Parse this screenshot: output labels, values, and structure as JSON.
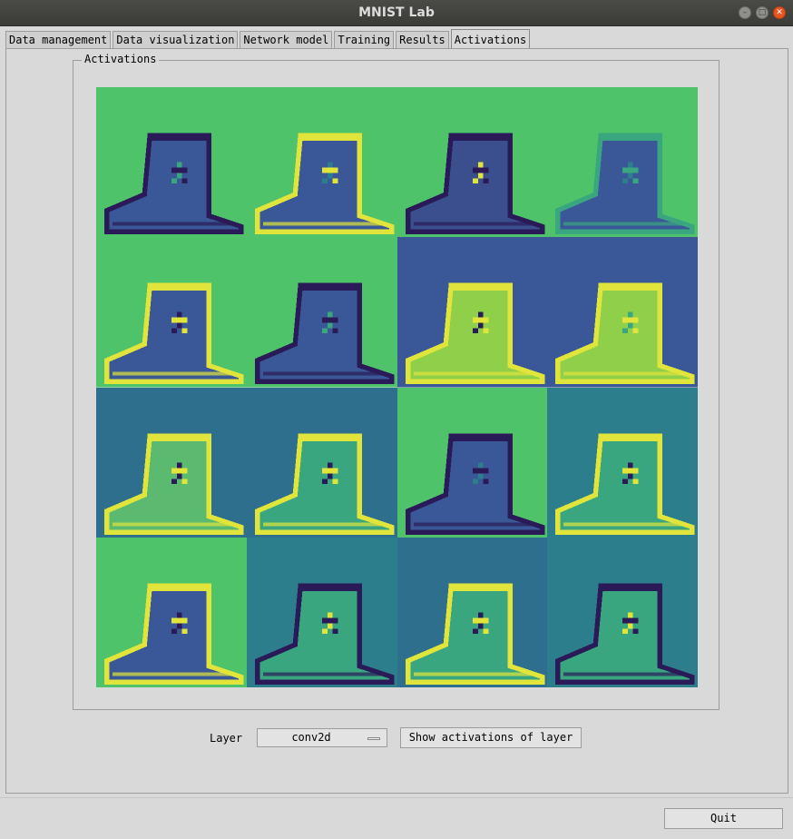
{
  "window": {
    "title": "MNIST Lab"
  },
  "tabs": [
    {
      "label": "Data management",
      "active": false
    },
    {
      "label": "Data visualization",
      "active": false
    },
    {
      "label": "Network model",
      "active": false
    },
    {
      "label": "Training",
      "active": false
    },
    {
      "label": "Results",
      "active": false
    },
    {
      "label": "Activations",
      "active": true
    }
  ],
  "activations": {
    "group_label": "Activations",
    "grid": {
      "rows": 4,
      "cols": 4
    },
    "maps": [
      {
        "bg": "#4fc36a",
        "fg": "#3a5897",
        "edge": "#2a1b58",
        "hi": "#3aa680"
      },
      {
        "bg": "#4fc36a",
        "fg": "#3a5897",
        "edge": "#e1e53b",
        "hi": "#2d7e8d"
      },
      {
        "bg": "#4fc36a",
        "fg": "#3b4f8e",
        "edge": "#2a1b58",
        "hi": "#e1e53b"
      },
      {
        "bg": "#4fc36a",
        "fg": "#3a5897",
        "edge": "#3aa680",
        "hi": "#2d7e8d"
      },
      {
        "bg": "#4fc36a",
        "fg": "#3a5897",
        "edge": "#e1e53b",
        "hi": "#2a1b58"
      },
      {
        "bg": "#4fc36a",
        "fg": "#3a5897",
        "edge": "#2a1b58",
        "hi": "#3aa680"
      },
      {
        "bg": "#3a5897",
        "fg": "#8fcf4a",
        "edge": "#e1e53b",
        "hi": "#2a1b58"
      },
      {
        "bg": "#3a5897",
        "fg": "#8fcf4a",
        "edge": "#e1e53b",
        "hi": "#3aa680"
      },
      {
        "bg": "#2d6f8d",
        "fg": "#5bb970",
        "edge": "#e1e53b",
        "hi": "#2a1b58"
      },
      {
        "bg": "#2d6f8d",
        "fg": "#3aa680",
        "edge": "#e1e53b",
        "hi": "#2a1b58"
      },
      {
        "bg": "#4fc36a",
        "fg": "#3a5897",
        "edge": "#2a1b58",
        "hi": "#2d7e8d"
      },
      {
        "bg": "#2d7e8d",
        "fg": "#3aa680",
        "edge": "#e1e53b",
        "hi": "#2a1b58"
      },
      {
        "bg": "#4fc36a",
        "fg": "#3a5897",
        "edge": "#e1e53b",
        "hi": "#2a1b58"
      },
      {
        "bg": "#2d7e8d",
        "fg": "#3aa680",
        "edge": "#2a1b58",
        "hi": "#e1e53b"
      },
      {
        "bg": "#2d6f8d",
        "fg": "#3aa680",
        "edge": "#e1e53b",
        "hi": "#2a1b58"
      },
      {
        "bg": "#2d7e8d",
        "fg": "#3aa680",
        "edge": "#2a1b58",
        "hi": "#e1e53b"
      }
    ]
  },
  "controls": {
    "layer_label": "Layer",
    "layer_select": {
      "value": "conv2d"
    },
    "show_button": "Show activations of layer"
  },
  "footer": {
    "quit_button": "Quit"
  }
}
